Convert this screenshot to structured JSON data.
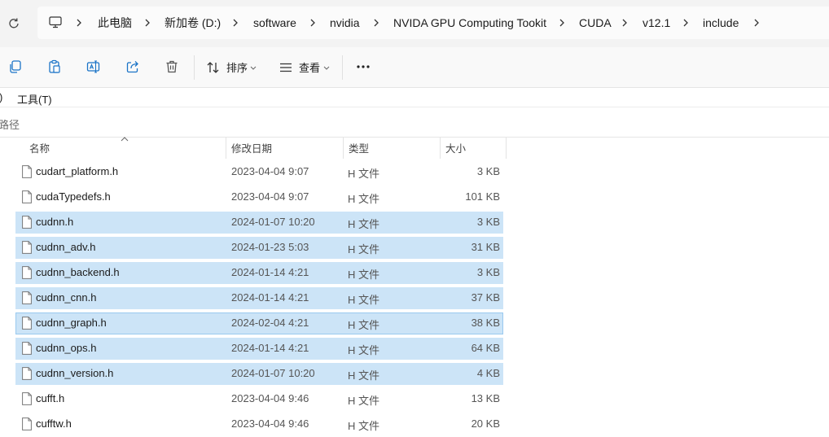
{
  "address_bar": {
    "breadcrumbs": [
      "此电脑",
      "新加卷 (D:)",
      "software",
      "nvidia",
      "NVIDA GPU Computing Tookit",
      "CUDA",
      "v12.1",
      "include"
    ]
  },
  "command_bar": {
    "sort_label": "排序",
    "view_label": "查看",
    "more_label": "..."
  },
  "menu": {
    "partial_item": ")",
    "tools": "工具(T)"
  },
  "path_bar": {
    "text": "路径"
  },
  "columns": {
    "name": "名称",
    "date": "修改日期",
    "type": "类型",
    "size": "大小"
  },
  "files": [
    {
      "name": "cudart_platform.h",
      "date": "2023-04-04 9:07",
      "type": "H 文件",
      "size": "3 KB",
      "selected": false
    },
    {
      "name": "cudaTypedefs.h",
      "date": "2023-04-04 9:07",
      "type": "H 文件",
      "size": "101 KB",
      "selected": false
    },
    {
      "name": "cudnn.h",
      "date": "2024-01-07 10:20",
      "type": "H 文件",
      "size": "3 KB",
      "selected": true
    },
    {
      "name": "cudnn_adv.h",
      "date": "2024-01-23 5:03",
      "type": "H 文件",
      "size": "31 KB",
      "selected": true
    },
    {
      "name": "cudnn_backend.h",
      "date": "2024-01-14 4:21",
      "type": "H 文件",
      "size": "3 KB",
      "selected": true
    },
    {
      "name": "cudnn_cnn.h",
      "date": "2024-01-14 4:21",
      "type": "H 文件",
      "size": "37 KB",
      "selected": true
    },
    {
      "name": "cudnn_graph.h",
      "date": "2024-02-04 4:21",
      "type": "H 文件",
      "size": "38 KB",
      "selected": true
    },
    {
      "name": "cudnn_ops.h",
      "date": "2024-01-14 4:21",
      "type": "H 文件",
      "size": "64 KB",
      "selected": true
    },
    {
      "name": "cudnn_version.h",
      "date": "2024-01-07 10:20",
      "type": "H 文件",
      "size": "4 KB",
      "selected": true
    },
    {
      "name": "cufft.h",
      "date": "2023-04-04 9:46",
      "type": "H 文件",
      "size": "13 KB",
      "selected": false
    },
    {
      "name": "cufftw.h",
      "date": "2023-04-04 9:46",
      "type": "H 文件",
      "size": "20 KB",
      "selected": false
    }
  ],
  "colors": {
    "selection": "#cce4f7",
    "accent": "#1a73c7"
  }
}
